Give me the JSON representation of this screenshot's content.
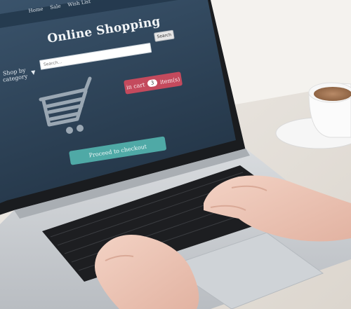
{
  "screen": {
    "nav": {
      "home": "Home",
      "sale": "Sale",
      "wish_list": "Wish List"
    },
    "title": "Online Shopping",
    "search": {
      "placeholder": "Search...",
      "button_label": "Search"
    },
    "shop_by": {
      "label_line1": "Shop by",
      "label_line2": "category",
      "arrow": "▼"
    },
    "cart": {
      "prefix": "in cart",
      "count": "3",
      "suffix": "item(s)"
    },
    "checkout_label": "Proceed to checkout",
    "icons": {
      "cart": "shopping-cart-icon",
      "dropdown": "caret-down-icon"
    }
  },
  "colors": {
    "screen_bg": "#2e4459",
    "cart_badge": "#c44a5d",
    "checkout_button": "#4fa9a6",
    "laptop_body": "#c8ccd0",
    "keyboard": "#1c1d20",
    "table": "#e8e4de"
  }
}
